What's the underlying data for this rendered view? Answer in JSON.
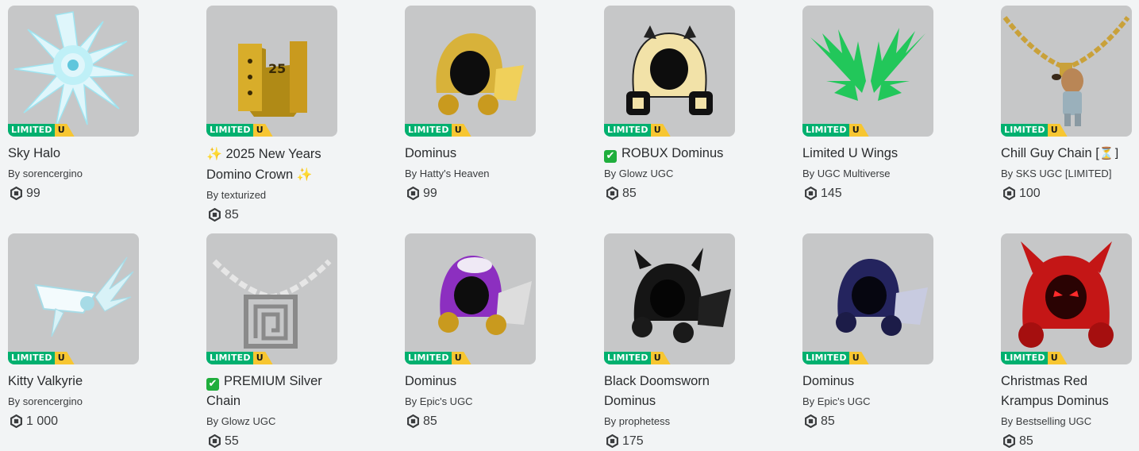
{
  "badge": {
    "limited": "LIMITED",
    "u": "U"
  },
  "by_label": "By",
  "items": [
    {
      "name_prefix": "",
      "name": "Sky Halo",
      "name_suffix": "",
      "creator": "sorencergino",
      "price": "99"
    },
    {
      "name_prefix": "✨",
      "name": " 2025 New Years Domino Crown ",
      "name_suffix": "✨",
      "creator": "texturized",
      "price": "85"
    },
    {
      "name_prefix": "",
      "name": "Dominus",
      "name_suffix": "",
      "creator": "Hatty's Heaven",
      "price": "99"
    },
    {
      "name_prefix": "✔",
      "name": "ROBUX Dominus",
      "name_suffix": "",
      "creator": "Glowz UGC",
      "price": "85"
    },
    {
      "name_prefix": "",
      "name": "Limited U Wings",
      "name_suffix": "",
      "creator": "UGC Multiverse",
      "price": "145"
    },
    {
      "name_prefix": "",
      "name": "Chill Guy Chain [",
      "name_suffix": "⏳]",
      "creator": "SKS UGC [LIMITED]",
      "price": "100"
    },
    {
      "name_prefix": "",
      "name": "Kitty Valkyrie",
      "name_suffix": "",
      "creator": "sorencergino",
      "price": "1 000"
    },
    {
      "name_prefix": "✔",
      "name": "PREMIUM Silver Chain",
      "name_suffix": "",
      "creator": "Glowz UGC",
      "price": "55"
    },
    {
      "name_prefix": "",
      "name": "Dominus",
      "name_suffix": "",
      "creator": "Epic's UGC",
      "price": "85"
    },
    {
      "name_prefix": "",
      "name": "Black Doomsworn Dominus",
      "name_suffix": "",
      "creator": "prophetess",
      "price": "175"
    },
    {
      "name_prefix": "",
      "name": "Dominus",
      "name_suffix": "",
      "creator": "Epic's UGC",
      "price": "85"
    },
    {
      "name_prefix": "",
      "name": "Christmas Red Krampus Dominus",
      "name_suffix": "",
      "creator": "Bestselling UGC",
      "price": "85"
    }
  ],
  "colors": {
    "limited_green": "#00b06f",
    "u_yellow": "#f7c631",
    "thumb_bg": "#c6c7c8",
    "check_green": "#1fae3c"
  },
  "icons": [
    "robux-icon",
    "sparkle-icon",
    "check-icon",
    "hourglass-icon"
  ]
}
